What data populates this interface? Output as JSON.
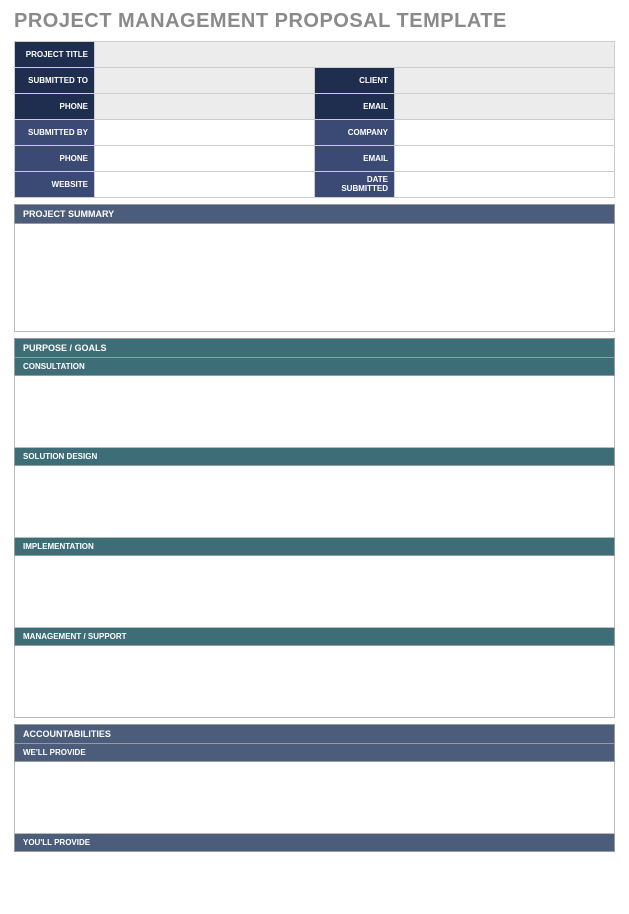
{
  "title": "PROJECT MANAGEMENT PROPOSAL TEMPLATE",
  "header": {
    "project_title_label": "PROJECT TITLE",
    "project_title": "",
    "submitted_to_label": "SUBMITTED TO",
    "submitted_to": "",
    "client_label": "CLIENT",
    "client": "",
    "phone_to_label": "PHONE",
    "phone_to": "",
    "email_to_label": "EMAIL",
    "email_to": "",
    "submitted_by_label": "SUBMITTED BY",
    "submitted_by": "",
    "company_label": "COMPANY",
    "company": "",
    "phone_by_label": "PHONE",
    "phone_by": "",
    "email_by_label": "EMAIL",
    "email_by": "",
    "website_label": "WEBSITE",
    "website": "",
    "date_submitted_label": "DATE SUBMITTED",
    "date_submitted": ""
  },
  "sections": {
    "project_summary": {
      "header": "PROJECT SUMMARY",
      "content": ""
    },
    "purpose_goals": {
      "header": "PURPOSE / GOALS",
      "consultation": {
        "label": "CONSULTATION",
        "content": ""
      },
      "solution_design": {
        "label": "SOLUTION DESIGN",
        "content": ""
      },
      "implementation": {
        "label": "IMPLEMENTATION",
        "content": ""
      },
      "management_support": {
        "label": "MANAGEMENT / SUPPORT",
        "content": ""
      }
    },
    "accountabilities": {
      "header": "ACCOUNTABILITIES",
      "well_provide": {
        "label": "WE'LL PROVIDE",
        "content": ""
      },
      "youll_provide": {
        "label": "YOU'LL PROVIDE",
        "content": ""
      }
    }
  }
}
